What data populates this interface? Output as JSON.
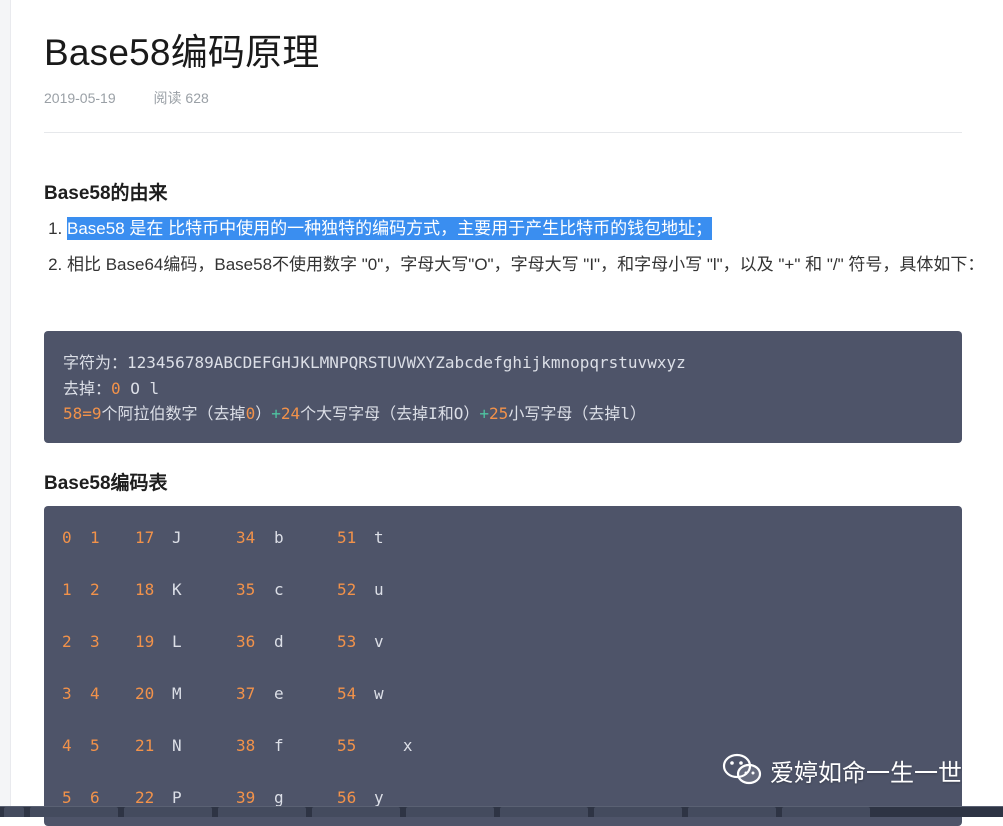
{
  "article": {
    "title": "Base58编码原理",
    "date": "2019-05-19",
    "reads": "阅读 628",
    "section1_heading": "Base58的由来",
    "list": [
      "Base58 是在 比特币中使用的一种独特的编码方式，主要用于产生比特币的钱包地址；",
      "相比 Base64编码，Base58不使用数字 \"0\"，字母大写\"O\"，字母大写 \"I\"，和字母小写 \"l\"，以及 \"+\" 和 \"/\" 符号，具体如下："
    ],
    "code_block_1": {
      "line1_label": "字符为：",
      "line1_value": "123456789ABCDEFGHJKLMNPQRSTUVWXYZabcdefghijkmnopqrstuvwxyz",
      "line2_label": "去掉：",
      "line2_num": "0",
      "line2_rest": " O l",
      "line3_a": "58",
      "line3_eq": "=",
      "line3_b": "9",
      "line3_c": "个阿拉伯数字（去掉",
      "line3_d": "0",
      "line3_e": "）",
      "line3_plus1": "+",
      "line3_f": "24",
      "line3_g": "个大写字母（去掉I和O）",
      "line3_plus2": "+",
      "line3_h": "25",
      "line3_i": "小写字母（去掉l）"
    },
    "section2_heading": "Base58编码表",
    "table_rows": [
      [
        [
          "0",
          "1"
        ],
        [
          "17",
          "J"
        ],
        [
          "34",
          "b"
        ],
        [
          "51",
          "t"
        ]
      ],
      [
        [
          "1",
          "2"
        ],
        [
          "18",
          "K"
        ],
        [
          "35",
          "c"
        ],
        [
          "52",
          "u"
        ]
      ],
      [
        [
          "2",
          "3"
        ],
        [
          "19",
          "L"
        ],
        [
          "36",
          "d"
        ],
        [
          "53",
          "v"
        ]
      ],
      [
        [
          "3",
          "4"
        ],
        [
          "20",
          "M"
        ],
        [
          "37",
          "e"
        ],
        [
          "54",
          "w"
        ]
      ],
      [
        [
          "4",
          "5"
        ],
        [
          "21",
          "N"
        ],
        [
          "38",
          "f"
        ],
        [
          "55",
          "   x"
        ]
      ],
      [
        [
          "5",
          "6"
        ],
        [
          "22",
          "P"
        ],
        [
          "39",
          "g"
        ],
        [
          "56",
          "y"
        ]
      ]
    ]
  },
  "watermark": {
    "text": "爱婷如命一生一世",
    "icon": "wechat-icon"
  },
  "colors": {
    "code_bg": "#4e5469",
    "number": "#f2924a",
    "operator": "#4fc3a1",
    "selection": "#3a8ef0"
  }
}
